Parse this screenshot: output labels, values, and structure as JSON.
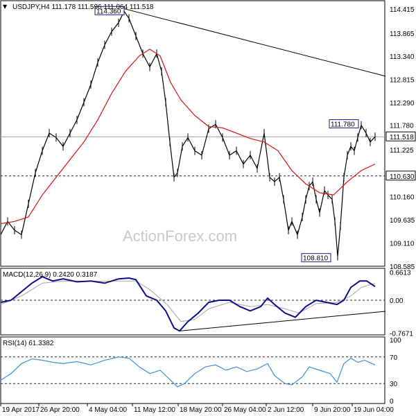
{
  "header": {
    "main": "USDJPY,H4  111.178 111.596 111.064 111.518",
    "macd": "MACD(12,26,9) 0.2420 0.3187",
    "rsi": "RSI(14) 61.3382"
  },
  "watermark": "ActionForex.com",
  "colors": {
    "price": "#000000",
    "ma": "#d42020",
    "macd": "#0b0b8c",
    "signal": "#b0b0b0",
    "rsi": "#3a8ee0",
    "trend": "#000000",
    "grid": "#555555",
    "callout_border": "#1a1a8c"
  },
  "chart_data": [
    {
      "type": "line",
      "panel": "price",
      "symbol": "USDJPY",
      "timeframe": "H4",
      "ylim": [
        108.585,
        114.6
      ],
      "y_ticks": [
        "114.415",
        "113.865",
        "113.340",
        "112.815",
        "112.290",
        "111.780",
        "111.518",
        "111.225",
        "110.630",
        "110.160",
        "109.635",
        "109.110",
        "108.585"
      ],
      "x_ticks": [
        "19 Apr 2017",
        "26 Apr 20:00",
        "4 May 04:00",
        "11 May 12:00",
        "18 May 20:00",
        "26 May 04:00",
        "2 Jun 12:00",
        "9 Jun 20:00",
        "19 Jun 04:00"
      ],
      "series": [
        {
          "name": "price",
          "points": [
            [
              0,
              109.3
            ],
            [
              10,
              109.6
            ],
            [
              20,
              109.4
            ],
            [
              30,
              109.3
            ],
            [
              40,
              110.0
            ],
            [
              50,
              110.7
            ],
            [
              60,
              111.2
            ],
            [
              70,
              111.6
            ],
            [
              80,
              111.5
            ],
            [
              90,
              111.3
            ],
            [
              100,
              111.6
            ],
            [
              110,
              111.9
            ],
            [
              120,
              112.3
            ],
            [
              130,
              112.7
            ],
            [
              140,
              113.2
            ],
            [
              150,
              113.6
            ],
            [
              160,
              113.9
            ],
            [
              170,
              114.1
            ],
            [
              178,
              114.36
            ],
            [
              185,
              114.2
            ],
            [
              195,
              113.8
            ],
            [
              205,
              113.4
            ],
            [
              215,
              113.1
            ],
            [
              225,
              113.4
            ],
            [
              232,
              113.0
            ],
            [
              238,
              112.3
            ],
            [
              244,
              111.4
            ],
            [
              250,
              110.6
            ],
            [
              255,
              110.7
            ],
            [
              262,
              111.3
            ],
            [
              270,
              111.5
            ],
            [
              280,
              111.2
            ],
            [
              290,
              111.1
            ],
            [
              300,
              111.7
            ],
            [
              310,
              111.8
            ],
            [
              320,
              111.5
            ],
            [
              330,
              111.1
            ],
            [
              340,
              111.2
            ],
            [
              350,
              110.9
            ],
            [
              360,
              111.1
            ],
            [
              370,
              110.8
            ],
            [
              380,
              111.6
            ],
            [
              388,
              110.6
            ],
            [
              395,
              110.5
            ],
            [
              402,
              110.6
            ],
            [
              408,
              110.1
            ],
            [
              415,
              109.4
            ],
            [
              420,
              109.6
            ],
            [
              428,
              109.3
            ],
            [
              435,
              109.7
            ],
            [
              440,
              110.1
            ],
            [
              445,
              110.4
            ],
            [
              450,
              110.5
            ],
            [
              455,
              110.1
            ],
            [
              460,
              109.8
            ],
            [
              467,
              110.3
            ],
            [
              472,
              110.2
            ],
            [
              478,
              110.1
            ],
            [
              482,
              109.6
            ],
            [
              486,
              108.81
            ],
            [
              490,
              109.5
            ],
            [
              495,
              110.6
            ],
            [
              500,
              111.1
            ],
            [
              505,
              111.3
            ],
            [
              510,
              111.2
            ],
            [
              515,
              111.5
            ],
            [
              520,
              111.78
            ],
            [
              527,
              111.6
            ],
            [
              533,
              111.4
            ],
            [
              540,
              111.518
            ]
          ]
        },
        {
          "name": "ma",
          "points": [
            [
              0,
              109.55
            ],
            [
              20,
              109.6
            ],
            [
              40,
              109.7
            ],
            [
              60,
              110.2
            ],
            [
              80,
              110.6
            ],
            [
              100,
              111.0
            ],
            [
              120,
              111.4
            ],
            [
              140,
              111.9
            ],
            [
              160,
              112.5
            ],
            [
              180,
              113.0
            ],
            [
              200,
              113.35
            ],
            [
              215,
              113.5
            ],
            [
              230,
              113.35
            ],
            [
              245,
              112.75
            ],
            [
              260,
              112.35
            ],
            [
              280,
              112.0
            ],
            [
              300,
              111.75
            ],
            [
              320,
              111.72
            ],
            [
              340,
              111.6
            ],
            [
              360,
              111.48
            ],
            [
              380,
              111.4
            ],
            [
              400,
              111.2
            ],
            [
              420,
              110.75
            ],
            [
              440,
              110.45
            ],
            [
              460,
              110.25
            ],
            [
              480,
              110.2
            ],
            [
              500,
              110.5
            ],
            [
              520,
              110.75
            ],
            [
              540,
              110.9
            ]
          ]
        }
      ],
      "trendline": {
        "from": [
          175,
          114.43
        ],
        "to": [
          555,
          112.89
        ]
      },
      "levels": [
        {
          "value": 111.518,
          "label": "111.518",
          "style": "solid"
        },
        {
          "value": 110.63,
          "label": "110.630",
          "style": "dashed"
        }
      ],
      "callouts": [
        {
          "label": "114.360",
          "x": 178,
          "y": 114.36
        },
        {
          "label": "111.780",
          "x": 520,
          "y": 111.78
        },
        {
          "label": "108.810",
          "x": 486,
          "y": 108.81
        }
      ]
    },
    {
      "type": "line",
      "panel": "macd",
      "ylim": [
        -0.7671,
        0.6613
      ],
      "y_ticks": [
        "0.6613",
        "0.00",
        "-0.7671"
      ],
      "series": [
        {
          "name": "MACD",
          "points": [
            [
              0,
              -0.05
            ],
            [
              15,
              0.0
            ],
            [
              30,
              0.2
            ],
            [
              45,
              0.4
            ],
            [
              60,
              0.55
            ],
            [
              75,
              0.45
            ],
            [
              90,
              0.5
            ],
            [
              110,
              0.43
            ],
            [
              130,
              0.45
            ],
            [
              150,
              0.4
            ],
            [
              170,
              0.5
            ],
            [
              185,
              0.52
            ],
            [
              195,
              0.48
            ],
            [
              210,
              0.1
            ],
            [
              225,
              0.0
            ],
            [
              238,
              -0.25
            ],
            [
              250,
              -0.65
            ],
            [
              258,
              -0.72
            ],
            [
              270,
              -0.5
            ],
            [
              285,
              -0.3
            ],
            [
              300,
              -0.05
            ],
            [
              315,
              0.0
            ],
            [
              330,
              0.0
            ],
            [
              345,
              -0.15
            ],
            [
              360,
              -0.25
            ],
            [
              375,
              -0.15
            ],
            [
              385,
              0.05
            ],
            [
              395,
              -0.1
            ],
            [
              410,
              -0.3
            ],
            [
              425,
              -0.4
            ],
            [
              440,
              -0.15
            ],
            [
              455,
              0.0
            ],
            [
              470,
              -0.05
            ],
            [
              485,
              -0.1
            ],
            [
              495,
              0.0
            ],
            [
              505,
              0.3
            ],
            [
              518,
              0.45
            ],
            [
              528,
              0.45
            ],
            [
              540,
              0.32
            ]
          ]
        },
        {
          "name": "Signal",
          "points": [
            [
              0,
              -0.1
            ],
            [
              30,
              0.1
            ],
            [
              60,
              0.4
            ],
            [
              90,
              0.45
            ],
            [
              130,
              0.44
            ],
            [
              170,
              0.45
            ],
            [
              195,
              0.45
            ],
            [
              215,
              0.25
            ],
            [
              240,
              -0.1
            ],
            [
              260,
              -0.5
            ],
            [
              280,
              -0.45
            ],
            [
              300,
              -0.2
            ],
            [
              330,
              -0.05
            ],
            [
              360,
              -0.15
            ],
            [
              385,
              -0.1
            ],
            [
              410,
              -0.2
            ],
            [
              430,
              -0.3
            ],
            [
              455,
              -0.08
            ],
            [
              485,
              -0.05
            ],
            [
              505,
              0.1
            ],
            [
              520,
              0.3
            ],
            [
              540,
              0.4
            ]
          ]
        }
      ],
      "trendline": {
        "from": [
          258,
          -0.72
        ],
        "to": [
          555,
          -0.26
        ]
      }
    },
    {
      "type": "line",
      "panel": "rsi",
      "ylim": [
        0,
        100
      ],
      "y_ticks": [
        "100",
        "70",
        "30",
        "0"
      ],
      "levels": [
        70,
        30
      ],
      "series": [
        {
          "name": "RSI",
          "points": [
            [
              0,
              35
            ],
            [
              15,
              45
            ],
            [
              30,
              60
            ],
            [
              45,
              67
            ],
            [
              60,
              65
            ],
            [
              75,
              62
            ],
            [
              90,
              60
            ],
            [
              110,
              63
            ],
            [
              130,
              58
            ],
            [
              150,
              65
            ],
            [
              170,
              70
            ],
            [
              185,
              68
            ],
            [
              200,
              55
            ],
            [
              215,
              45
            ],
            [
              230,
              50
            ],
            [
              245,
              35
            ],
            [
              255,
              25
            ],
            [
              265,
              30
            ],
            [
              280,
              45
            ],
            [
              295,
              55
            ],
            [
              310,
              58
            ],
            [
              325,
              50
            ],
            [
              340,
              55
            ],
            [
              355,
              48
            ],
            [
              370,
              52
            ],
            [
              385,
              60
            ],
            [
              395,
              42
            ],
            [
              410,
              30
            ],
            [
              420,
              28
            ],
            [
              435,
              40
            ],
            [
              445,
              55
            ],
            [
              460,
              50
            ],
            [
              475,
              45
            ],
            [
              485,
              32
            ],
            [
              495,
              60
            ],
            [
              505,
              68
            ],
            [
              515,
              62
            ],
            [
              525,
              65
            ],
            [
              540,
              58
            ]
          ]
        }
      ]
    }
  ]
}
